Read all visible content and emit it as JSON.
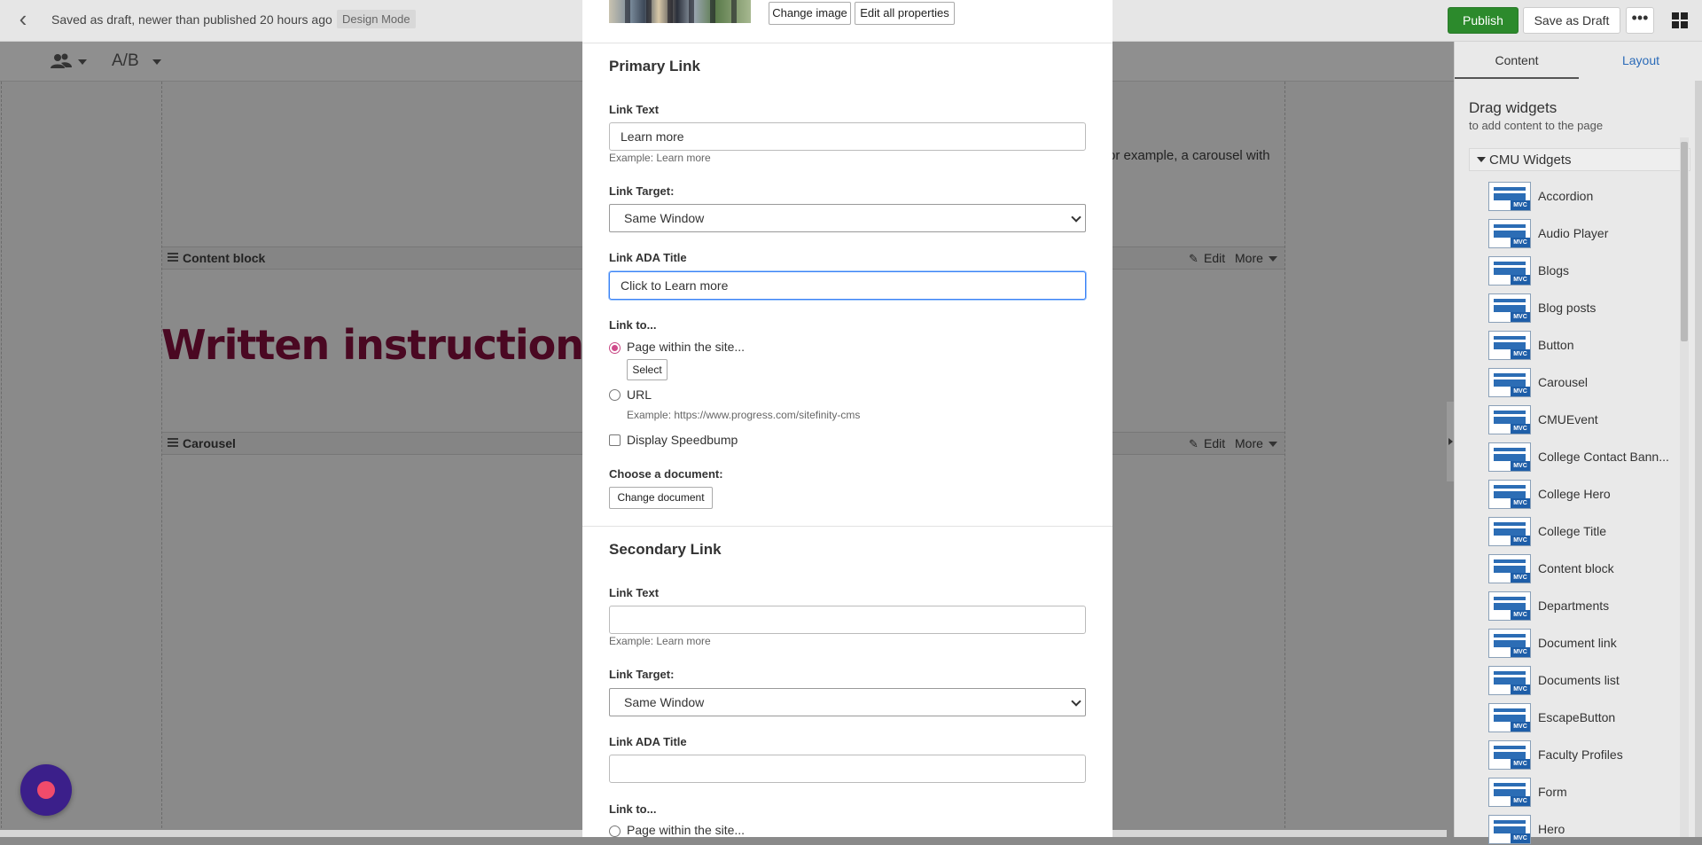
{
  "topbar": {
    "back_icon": "chevron-left-icon",
    "status": "Saved as draft, newer than published 20 hours ago",
    "mode": "Design Mode",
    "publish": "Publish",
    "save_draft": "Save as Draft",
    "more": "•••",
    "apps_icon": "grid-icon"
  },
  "toolbar": {
    "personas_icon": "users-icon",
    "ab": "A/B"
  },
  "canvas": {
    "behind_text": "or example, a carousel with",
    "blocks": [
      {
        "name": "Content block",
        "edit": "Edit",
        "more": "More"
      },
      {
        "name": "Carousel",
        "edit": "Edit",
        "more": "More"
      }
    ],
    "heading": "Written instructions"
  },
  "modal": {
    "change_image": "Change image",
    "edit_all": "Edit all properties",
    "primary": {
      "title": "Primary Link",
      "link_text_label": "Link Text",
      "link_text_value": "Learn more",
      "link_text_hint": "Example: Learn more",
      "target_label": "Link Target:",
      "target_value": "Same Window",
      "ada_label": "Link ADA Title",
      "ada_value": "Click to Learn more",
      "link_to_label": "Link to...",
      "opt_page": "Page within the site...",
      "select_btn": "Select",
      "opt_url": "URL",
      "url_hint": "Example: https://www.progress.com/sitefinity-cms",
      "speedbump": "Display Speedbump",
      "doc_label": "Choose a document:",
      "change_doc": "Change document"
    },
    "secondary": {
      "title": "Secondary Link",
      "link_text_label": "Link Text",
      "link_text_value": "",
      "link_text_hint": "Example: Learn more",
      "target_label": "Link Target:",
      "target_value": "Same Window",
      "ada_label": "Link ADA Title",
      "ada_value": "",
      "link_to_label": "Link to...",
      "opt_page": "Page within the site..."
    }
  },
  "sidebar": {
    "tabs": [
      "Content",
      "Layout"
    ],
    "title": "Drag widgets",
    "subtitle": "to add content to the page",
    "group": "CMU Widgets",
    "badge": "MVC",
    "widgets": [
      "Accordion",
      "Audio Player",
      "Blogs",
      "Blog posts",
      "Button",
      "Carousel",
      "CMUEvent",
      "College Contact Bann...",
      "College Hero",
      "College Title",
      "Content block",
      "Departments",
      "Document link",
      "Documents list",
      "EscapeButton",
      "Faculty Profiles",
      "Form",
      "Hero"
    ]
  },
  "colors": {
    "publish": "#2c8a2c",
    "accent_link": "#2a6ab8",
    "heading": "#4a0822",
    "radio_checked": "#d04b8b",
    "fab": "#3b1f8a"
  }
}
